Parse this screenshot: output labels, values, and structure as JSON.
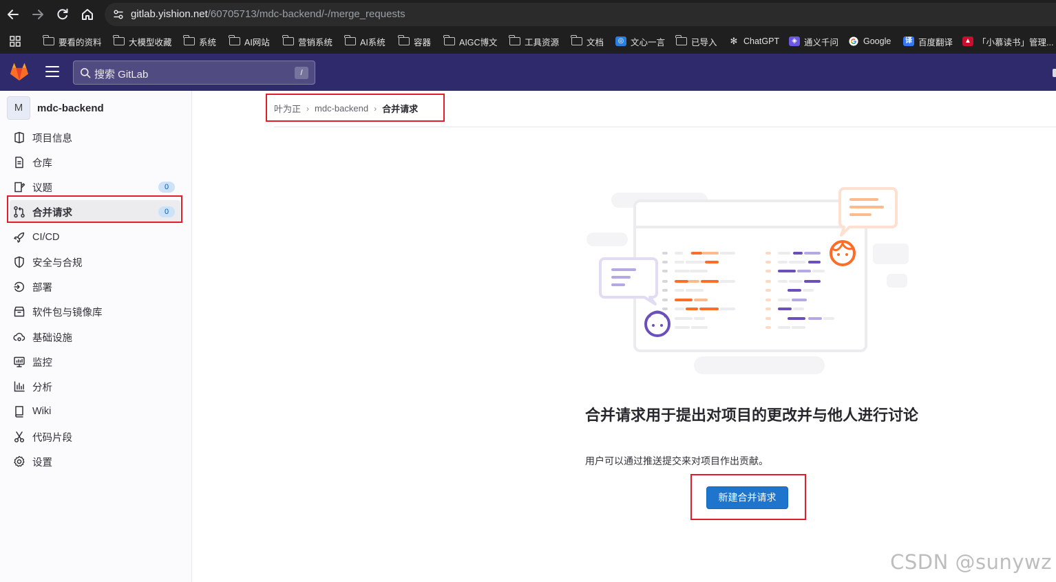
{
  "browser": {
    "url_host": "gitlab.yishion.net",
    "url_path": "/60705713/mdc-backend/-/merge_requests",
    "bookmarks": [
      {
        "label": "要看的资料",
        "icon": "folder-icon"
      },
      {
        "label": "大模型收藏",
        "icon": "folder-icon"
      },
      {
        "label": "系统",
        "icon": "folder-icon"
      },
      {
        "label": "AI网站",
        "icon": "folder-icon"
      },
      {
        "label": "营销系统",
        "icon": "folder-icon"
      },
      {
        "label": "AI系统",
        "icon": "folder-icon"
      },
      {
        "label": "容器",
        "icon": "folder-icon"
      },
      {
        "label": "AIGC博文",
        "icon": "folder-icon"
      },
      {
        "label": "工具资源",
        "icon": "folder-icon"
      },
      {
        "label": "文档",
        "icon": "folder-icon"
      },
      {
        "label": "文心一言",
        "icon": "wenxin-icon"
      },
      {
        "label": "已导入",
        "icon": "folder-icon"
      },
      {
        "label": "ChatGPT",
        "icon": "chatgpt-icon"
      },
      {
        "label": "通义千问",
        "icon": "tongyi-icon"
      },
      {
        "label": "Google",
        "icon": "google-icon"
      },
      {
        "label": "百度翻译",
        "icon": "baidu-translate-icon"
      },
      {
        "label": "「小慕读书」管理...",
        "icon": "xiaomu-icon"
      }
    ]
  },
  "header": {
    "search_placeholder": "搜索 GitLab",
    "search_shortcut": "/"
  },
  "sidebar": {
    "project_avatar": "M",
    "project_name": "mdc-backend",
    "items": [
      {
        "label": "项目信息",
        "icon": "project-info-icon"
      },
      {
        "label": "仓库",
        "icon": "repository-icon"
      },
      {
        "label": "议题",
        "icon": "issues-icon",
        "badge": "0"
      },
      {
        "label": "合并请求",
        "icon": "merge-request-icon",
        "badge": "0",
        "active": true
      },
      {
        "label": "CI/CD",
        "icon": "rocket-icon"
      },
      {
        "label": "安全与合规",
        "icon": "shield-icon"
      },
      {
        "label": "部署",
        "icon": "deploy-icon"
      },
      {
        "label": "软件包与镜像库",
        "icon": "package-icon"
      },
      {
        "label": "基础设施",
        "icon": "cloud-gear-icon"
      },
      {
        "label": "监控",
        "icon": "monitor-icon"
      },
      {
        "label": "分析",
        "icon": "chart-icon"
      },
      {
        "label": "Wiki",
        "icon": "book-icon"
      },
      {
        "label": "代码片段",
        "icon": "scissors-icon"
      },
      {
        "label": "设置",
        "icon": "gear-icon"
      }
    ]
  },
  "breadcrumb": [
    "叶为正",
    "mdc-backend",
    "合并请求"
  ],
  "empty_state": {
    "title": "合并请求用于提出对项目的更改并与他人进行讨论",
    "description": "用户可以通过推送提交来对项目作出贡献。",
    "button_label": "新建合并请求"
  },
  "watermark": "CSDN @sunywz",
  "colors": {
    "gitlab_header": "#2f2a6b",
    "primary_button": "#1f75cb",
    "annotation_red": "#e11d2a",
    "badge_bg": "#cbe2f9"
  }
}
